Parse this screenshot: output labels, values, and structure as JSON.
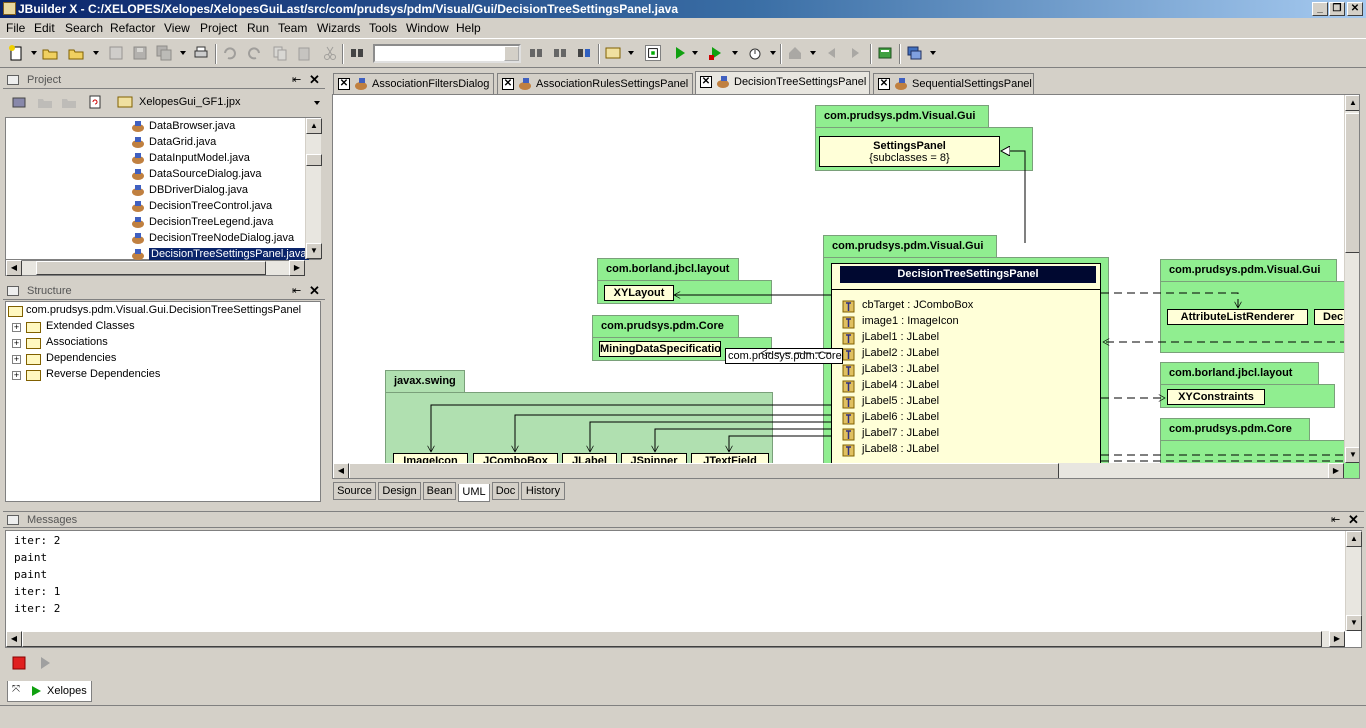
{
  "window": {
    "title": "JBuilder X - C:/XELOPES/Xelopes/XelopesGuiLast/src/com/prudsys/pdm/Visual/Gui/DecisionTreeSettingsPanel.java",
    "minimize": "_",
    "restore": "❐",
    "close": "✕"
  },
  "menu": [
    "File",
    "Edit",
    "Search",
    "Refactor",
    "View",
    "Project",
    "Run",
    "Team",
    "Wizards",
    "Tools",
    "Window",
    "Help"
  ],
  "project_panel": {
    "title": "Project",
    "project_file": "XelopesGui_GF1.jpx",
    "files": [
      "DataBrowser.java",
      "DataGrid.java",
      "DataInputModel.java",
      "DataSourceDialog.java",
      "DBDriverDialog.java",
      "DecisionTreeControl.java",
      "DecisionTreeLegend.java",
      "DecisionTreeNodeDialog.java",
      "DecisionTreeSettingsPanel.java"
    ],
    "selected_file": "DecisionTreeSettingsPanel.java"
  },
  "structure_panel": {
    "title": "Structure",
    "root": "com.prudsys.pdm.Visual.Gui.DecisionTreeSettingsPanel",
    "nodes": [
      "Extended Classes",
      "Associations",
      "Dependencies",
      "Reverse Dependencies"
    ]
  },
  "editor_tabs": [
    "AssociationFiltersDialog",
    "AssociationRulesSettingsPanel",
    "DecisionTreeSettingsPanel",
    "SequentialSettingsPanel"
  ],
  "active_editor_tab": "DecisionTreeSettingsPanel",
  "bottom_tabs": [
    "Source",
    "Design",
    "Bean",
    "UML",
    "Doc",
    "History"
  ],
  "active_bottom_tab": "UML",
  "uml": {
    "pkg_top": "com.prudsys.pdm.Visual.Gui",
    "settings_panel": "SettingsPanel",
    "settings_panel_sub": "{subclasses = 8}",
    "pkg_main": "com.prudsys.pdm.Visual.Gui",
    "main_class": "DecisionTreeSettingsPanel",
    "members": [
      "cbTarget : JComboBox",
      "image1 : ImageIcon",
      "jLabel1 : JLabel",
      "jLabel2 : JLabel",
      "jLabel3 : JLabel",
      "jLabel4 : JLabel",
      "jLabel5 : JLabel",
      "jLabel6 : JLabel",
      "jLabel7 : JLabel",
      "jLabel8 : JLabel"
    ],
    "pkg_layout_left": "com.borland.jbcl.layout",
    "xylayout": "XYLayout",
    "pkg_core_left": "com.prudsys.pdm.Core",
    "mining_spec": "MiningDataSpecification",
    "tooltip": "com.prudsys.pdm.Core",
    "pkg_swing": "javax.swing",
    "swing_classes": [
      "ImageIcon",
      "JComboBox",
      "JLabel",
      "JSpinner",
      "JTextField"
    ],
    "pkg_right_gui": "com.prudsys.pdm.Visual.Gui",
    "attr_renderer": "AttributeListRenderer",
    "dec_partial": "Dec",
    "pkg_right_layout": "com.borland.jbcl.layout",
    "xyconstraints": "XYConstraints",
    "pkg_right_core": "com.prudsys.pdm.Core"
  },
  "messages": {
    "title": "Messages",
    "lines": [
      "iter: 2",
      "paint",
      "paint",
      "iter: 1",
      "iter: 2"
    ],
    "run_tab": "Xelopes"
  },
  "colors": {
    "title_gradient_start": "#0a246a",
    "package_green": "#90ee90",
    "class_yellow": "#ffffd8",
    "selection_blue": "#0a246a"
  }
}
